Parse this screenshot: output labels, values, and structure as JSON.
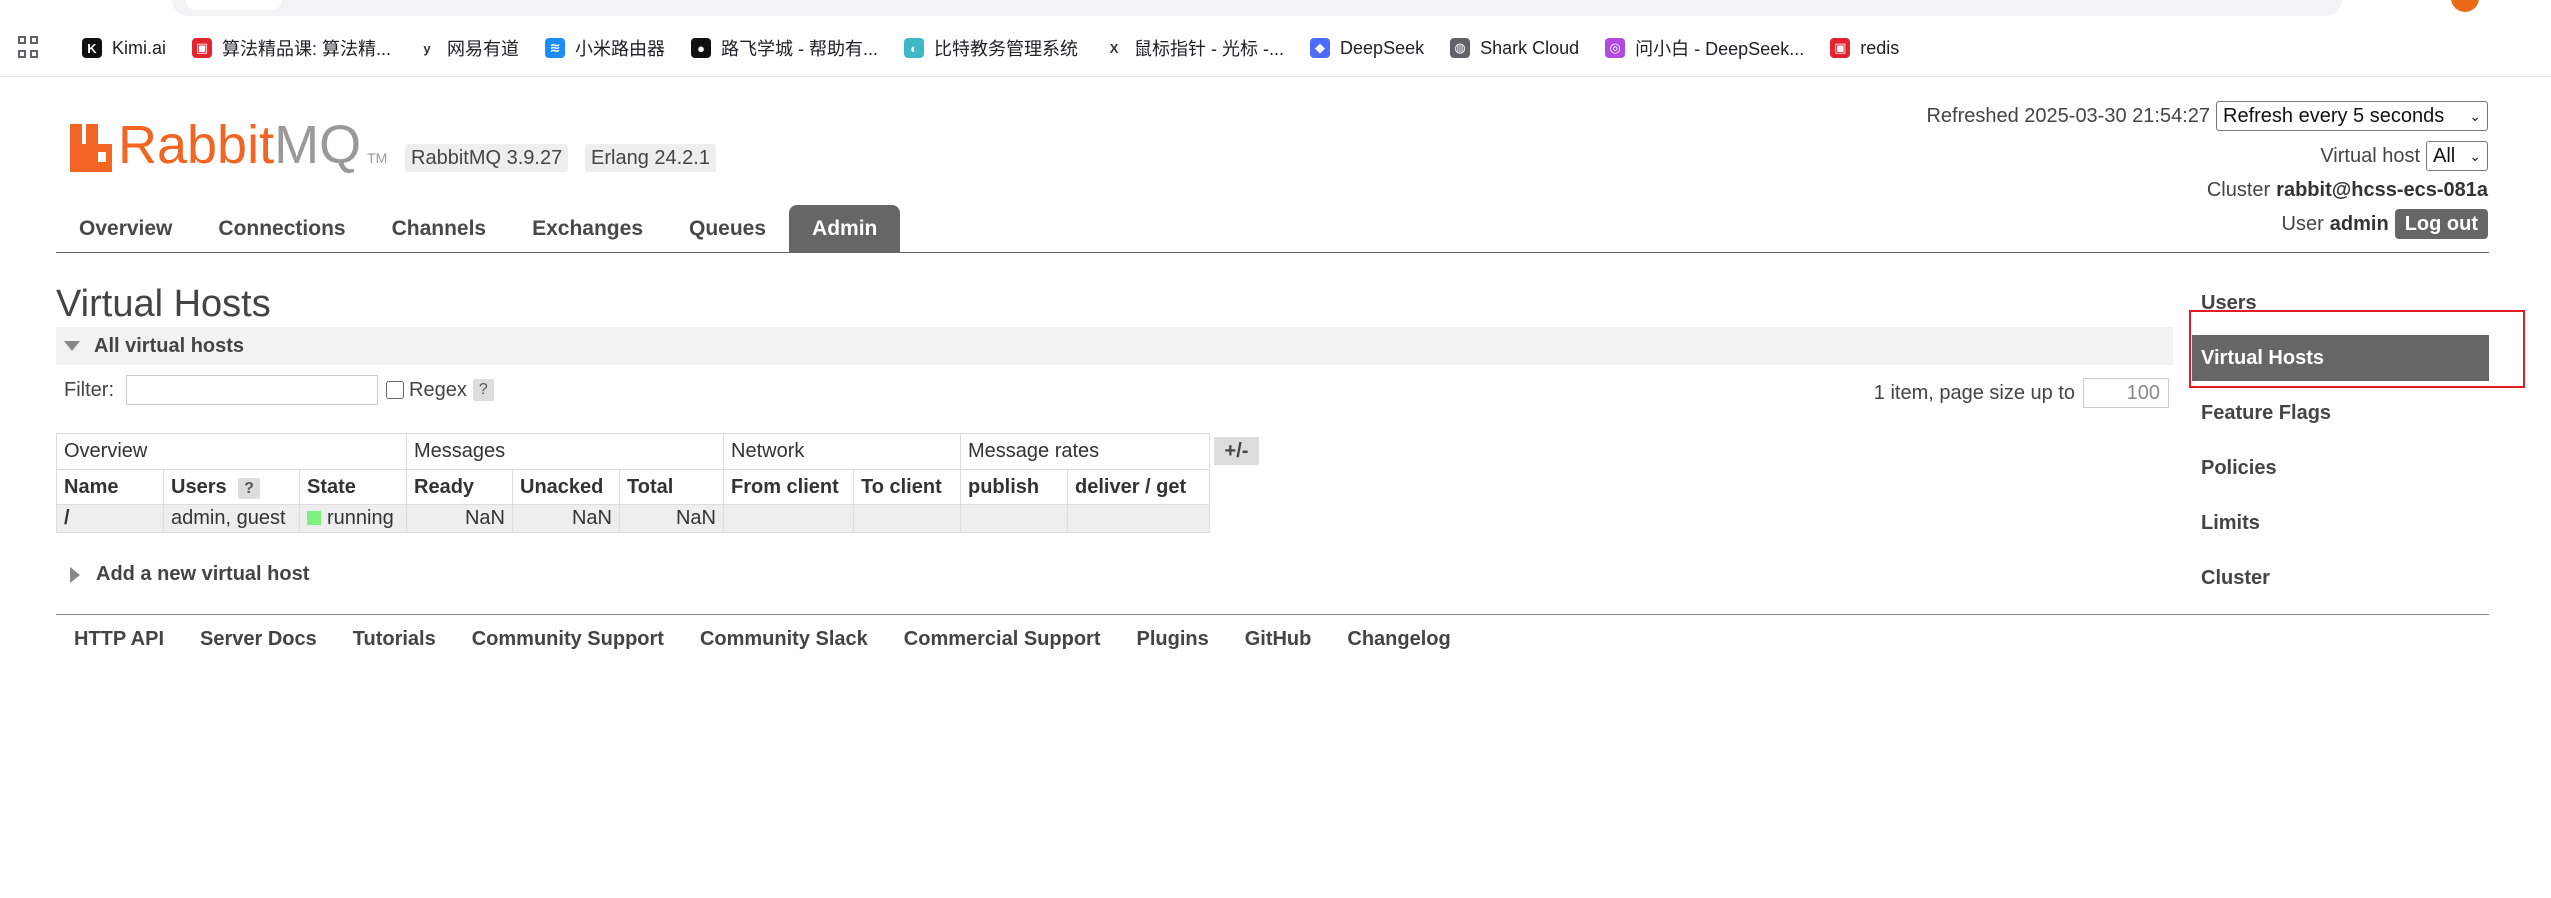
{
  "browser": {
    "bookmarks": [
      {
        "label": "Kimi.ai",
        "icon": "kimi-icon",
        "color": "#111111",
        "glyph": "K"
      },
      {
        "label": "算法精品课: 算法精...",
        "icon": "algo-icon",
        "color": "#e4232e",
        "glyph": "▣"
      },
      {
        "label": "网易有道",
        "icon": "youdao-icon",
        "color": "#ffffff",
        "glyph": "y"
      },
      {
        "label": "小米路由器",
        "icon": "xiaomi-router-icon",
        "color": "#1a8cff",
        "glyph": "≋"
      },
      {
        "label": "路飞学城 - 帮助有...",
        "icon": "luffy-icon",
        "color": "#111111",
        "glyph": "●"
      },
      {
        "label": "比特教务管理系统",
        "icon": "bit-icon",
        "color": "#3fb8c8",
        "glyph": "◐"
      },
      {
        "label": "鼠标指针 - 光标 -...",
        "icon": "cursor-icon",
        "color": "#ffffff",
        "glyph": "X"
      },
      {
        "label": "DeepSeek",
        "icon": "deepseek-icon",
        "color": "#4d6bfe",
        "glyph": "◆"
      },
      {
        "label": "Shark Cloud",
        "icon": "globe-icon",
        "color": "#5f6368",
        "glyph": "◍"
      },
      {
        "label": "问小白 - DeepSeek...",
        "icon": "wenxiaobai-icon",
        "color": "#b04ae0",
        "glyph": "◎"
      },
      {
        "label": "redis",
        "icon": "redis-icon",
        "color": "#e4232e",
        "glyph": "▣"
      }
    ]
  },
  "header": {
    "logo_rabbit": "Rabbit",
    "logo_mq": "MQ",
    "logo_tm": "TM",
    "rabbit_version": "RabbitMQ 3.9.27",
    "erlang_version": "Erlang 24.2.1",
    "refreshed_label": "Refreshed 2025-03-30 21:54:27",
    "refresh_select": "Refresh every 5 seconds",
    "vhost_label": "Virtual host",
    "vhost_select": "All",
    "cluster_label": "Cluster",
    "cluster_name": "rabbit@hcss-ecs-081a",
    "user_label": "User",
    "user_name": "admin",
    "logout": "Log out"
  },
  "tabs": [
    "Overview",
    "Connections",
    "Channels",
    "Exchanges",
    "Queues",
    "Admin"
  ],
  "active_tab": "Admin",
  "main": {
    "title": "Virtual Hosts",
    "section": "All virtual hosts",
    "filter_label": "Filter:",
    "regex_label": "Regex",
    "help": "?",
    "paging_text": "1 item, page size up to",
    "page_size": "100",
    "plus_minus": "+/-",
    "add_vhost": "Add a new virtual host"
  },
  "table": {
    "groups": [
      "Overview",
      "Messages",
      "Network",
      "Message rates"
    ],
    "columns": [
      "Name",
      "Users",
      "State",
      "Ready",
      "Unacked",
      "Total",
      "From client",
      "To client",
      "publish",
      "deliver / get"
    ],
    "users_help": "?",
    "rows": [
      {
        "name": "/",
        "users": "admin, guest",
        "state": "running",
        "ready": "NaN",
        "unacked": "NaN",
        "total": "NaN",
        "from_client": "",
        "to_client": "",
        "publish": "",
        "deliver_get": ""
      }
    ]
  },
  "admin_menu": [
    "Users",
    "Virtual Hosts",
    "Feature Flags",
    "Policies",
    "Limits",
    "Cluster"
  ],
  "admin_menu_active": "Virtual Hosts",
  "footer": [
    "HTTP API",
    "Server Docs",
    "Tutorials",
    "Community Support",
    "Community Slack",
    "Commercial Support",
    "Plugins",
    "GitHub",
    "Changelog"
  ],
  "colors": {
    "brand_orange": "#f26522",
    "active_tab": "#666666",
    "highlight": "#e21d26",
    "running_green": "#7df07d"
  }
}
